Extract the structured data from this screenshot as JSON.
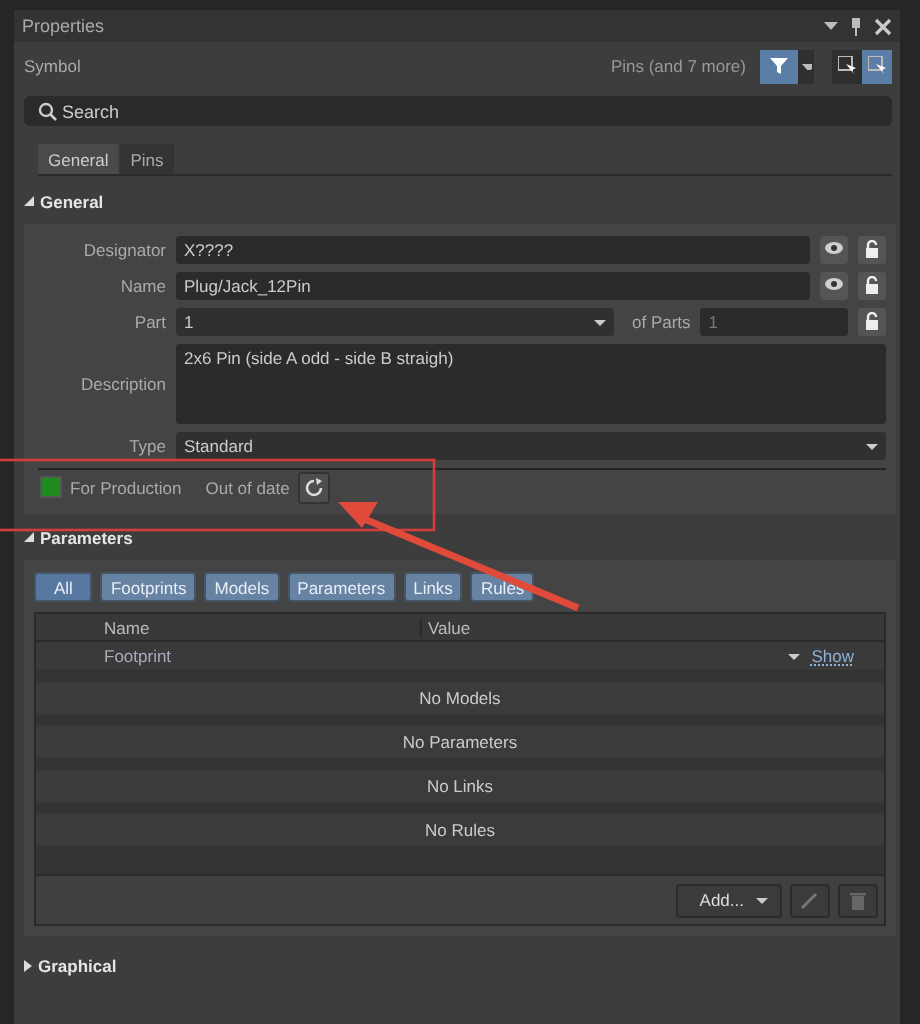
{
  "panel": {
    "title": "Properties"
  },
  "header": {
    "object": "Symbol",
    "filter_summary": "Pins (and 7 more)"
  },
  "search": {
    "placeholder": "Search"
  },
  "tabs": [
    {
      "label": "General",
      "selected": true
    },
    {
      "label": "Pins",
      "selected": false
    }
  ],
  "general": {
    "title": "General",
    "expanded": true,
    "fields": [
      {
        "kind": "text",
        "label": "Designator",
        "value": "X????"
      },
      {
        "kind": "text",
        "label": "Name",
        "value": "Plug/Jack_12Pin"
      },
      {
        "kind": "part",
        "label": "Part",
        "value": "1",
        "of_label": "of Parts",
        "of_value": "1"
      },
      {
        "kind": "multiline",
        "label": "Description",
        "value": "2x6 Pin (side A odd - side B straigh)"
      },
      {
        "kind": "select",
        "label": "Type",
        "value": "Standard"
      }
    ],
    "status": {
      "color": "#1f8a1f",
      "label": "For Production",
      "state": "Out of date"
    }
  },
  "parameters": {
    "title": "Parameters",
    "expanded": true,
    "filters": [
      {
        "label": "All",
        "selected": true
      },
      {
        "label": "Footprints",
        "selected": false
      },
      {
        "label": "Models",
        "selected": false
      },
      {
        "label": "Parameters",
        "selected": false
      },
      {
        "label": "Links",
        "selected": false
      },
      {
        "label": "Rules",
        "selected": false
      }
    ],
    "columns": [
      "Name",
      "Value"
    ],
    "rows": [
      {
        "name": "Footprint",
        "link": "Show"
      }
    ],
    "empty_groups": [
      "No Models",
      "No Parameters",
      "No Links",
      "No Rules"
    ],
    "add_button": "Add..."
  },
  "graphical": {
    "title": "Graphical",
    "expanded": false
  }
}
